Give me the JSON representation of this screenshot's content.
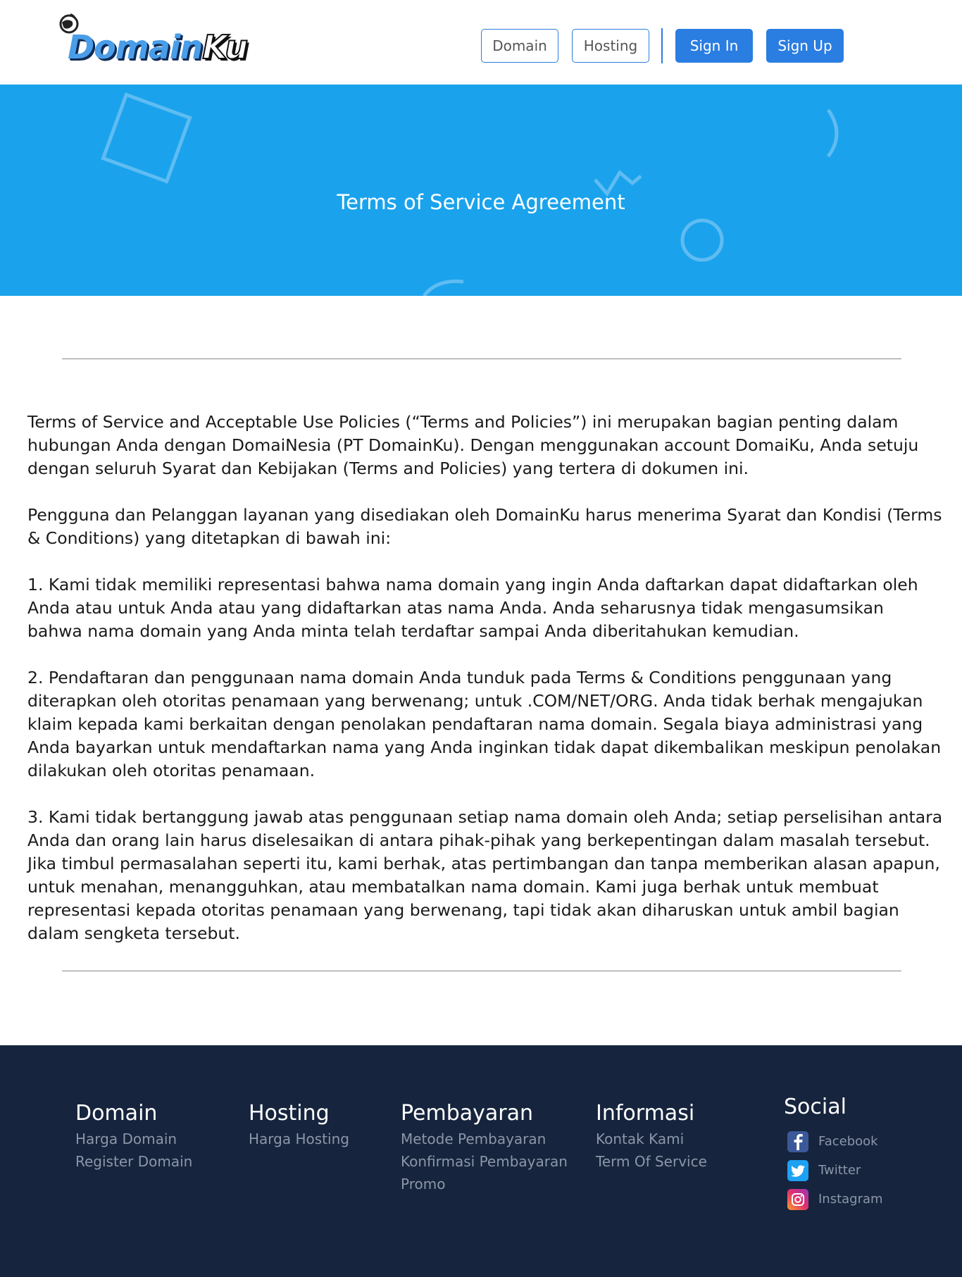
{
  "navbar": {
    "logo_text_domain": "Domain",
    "logo_text_ku": "Ku",
    "links": [
      "Domain",
      "Hosting"
    ],
    "sign_in": "Sign In",
    "sign_up": "Sign Up",
    "accent_color": "#2a7de1"
  },
  "hero": {
    "title": "Terms of Service Agreement",
    "background_color": "#1aa3ec"
  },
  "content": {
    "paragraphs": [
      "Terms of Service and Acceptable Use Policies (“Terms and Policies”) ini merupakan bagian penting dalam hubungan Anda dengan DomaiNesia (PT DomainKu). Dengan menggunakan account DomaiKu, Anda setuju dengan seluruh Syarat dan Kebijakan (Terms and Policies) yang tertera di dokumen ini.",
      "Pengguna dan Pelanggan layanan yang disediakan oleh DomainKu harus menerima Syarat dan Kondisi (Terms & Conditions) yang ditetapkan di bawah ini:",
      "1. Kami tidak memiliki representasi bahwa nama domain yang ingin Anda daftarkan dapat didaftarkan oleh Anda atau untuk Anda atau yang didaftarkan atas nama Anda. Anda seharusnya tidak mengasumsikan bahwa nama domain yang Anda minta telah terdaftar sampai Anda diberitahukan kemudian.",
      "2. Pendaftaran dan penggunaan nama domain Anda tunduk pada Terms & Conditions penggunaan yang diterapkan oleh otoritas penamaan yang berwenang; untuk .COM/NET/ORG. Anda tidak berhak mengajukan klaim kepada kami berkaitan dengan penolakan pendaftaran nama domain. Segala biaya administrasi yang Anda bayarkan untuk mendaftarkan nama yang Anda inginkan tidak dapat dikembalikan meskipun penolakan dilakukan oleh otoritas penamaan.",
      "3. Kami tidak bertanggung jawab atas penggunaan setiap nama domain oleh Anda; setiap perselisihan antara Anda dan orang lain harus diselesaikan di antara pihak-pihak yang berkepentingan dalam masalah tersebut. Jika timbul permasalahan seperti itu, kami berhak, atas pertimbangan dan tanpa memberikan alasan apapun, untuk menahan, menangguhkan, atau membatalkan nama domain. Kami juga berhak untuk membuat representasi kepada otoritas penamaan yang berwenang, tapi tidak akan diharuskan untuk ambil bagian dalam sengketa tersebut."
    ]
  },
  "footer": {
    "background_color": "#16243d",
    "columns": [
      {
        "heading": "Domain",
        "links": [
          "Harga Domain",
          "Register Domain"
        ]
      },
      {
        "heading": "Hosting",
        "links": [
          "Harga Hosting"
        ]
      },
      {
        "heading": "Pembayaran",
        "links": [
          "Metode Pembayaran",
          "Konfirmasi Pembayaran",
          "Promo"
        ]
      },
      {
        "heading": "Informasi",
        "links": [
          "Kontak Kami",
          "Term Of Service"
        ]
      }
    ],
    "social": {
      "heading": "Social",
      "items": [
        {
          "label": "Facebook",
          "icon": "facebook-icon",
          "color": "#3b5998"
        },
        {
          "label": "Twitter",
          "icon": "twitter-icon",
          "color": "#1da1f2"
        },
        {
          "label": "Instagram",
          "icon": "instagram-icon",
          "color": "#e1306c"
        }
      ]
    }
  }
}
